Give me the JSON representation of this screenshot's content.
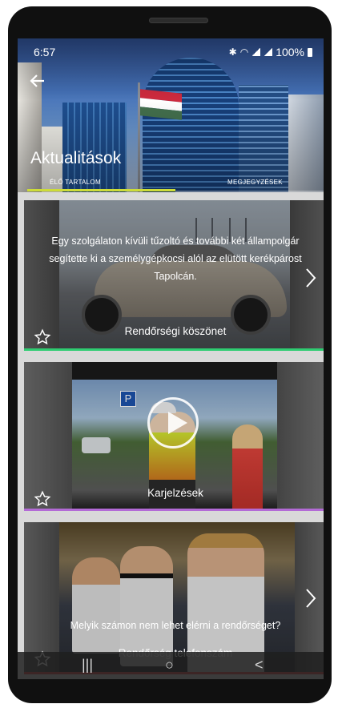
{
  "status_bar": {
    "time": "6:57",
    "battery": "100%"
  },
  "header": {
    "title": "Aktualitások",
    "tabs": [
      {
        "label": "ÉLŐ TARTALOM",
        "selected": true
      },
      {
        "label": "MEGJEGYZÉSEK",
        "selected": false
      }
    ],
    "accent_color": "#cddc39"
  },
  "cards": [
    {
      "description": "Egy szolgálaton kívüli tűzoltó és további két állampolgár segítette ki a személygépkocsi alól az elütött kerékpárost Tapolcán.",
      "title": "Rendőrségi köszönet",
      "accent_color": "#2ecc71",
      "has_next": true,
      "is_video": false
    },
    {
      "description": "",
      "title": "Karjelzések",
      "accent_color": "#b36bd6",
      "has_next": false,
      "is_video": true
    },
    {
      "description": "Melyik számon nem lehet elérni a rendőrséget?",
      "title": "Rendőrség telefonszám",
      "accent_color": "#e24a4a",
      "has_next": true,
      "is_video": false
    }
  ],
  "icons": {
    "back": "arrow-left-icon",
    "favorite": "star-outline-icon",
    "next": "chevron-right-icon",
    "play": "play-icon"
  },
  "nav_bar": {
    "recents": "|||",
    "home": "○",
    "back": "<"
  }
}
